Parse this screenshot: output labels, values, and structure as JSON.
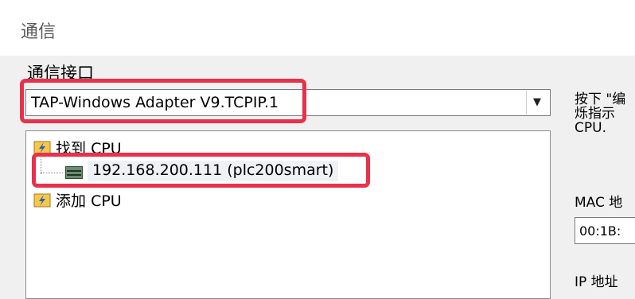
{
  "window": {
    "title": "通信"
  },
  "interface_section": {
    "label": "通信接口",
    "selected_adapter": "TAP-Windows Adapter V9.TCPIP.1",
    "dropdown_arrow": "▼"
  },
  "tree": {
    "found_cpu_label": "找到 CPU",
    "found_device": "192.168.200.111 (plc200smart)",
    "add_cpu_label": "添加 CPU",
    "icons": {
      "folder": "flash-folder-icon",
      "device": "plc-device-icon"
    }
  },
  "right_panel": {
    "hint_line1": "按下 \"编",
    "hint_line2": "烁指示",
    "hint_line3": "CPU.",
    "mac_label": "MAC 地",
    "mac_value": "00:1B:",
    "ip_label": "IP 地址"
  },
  "colors": {
    "highlight": "#e8314b"
  }
}
